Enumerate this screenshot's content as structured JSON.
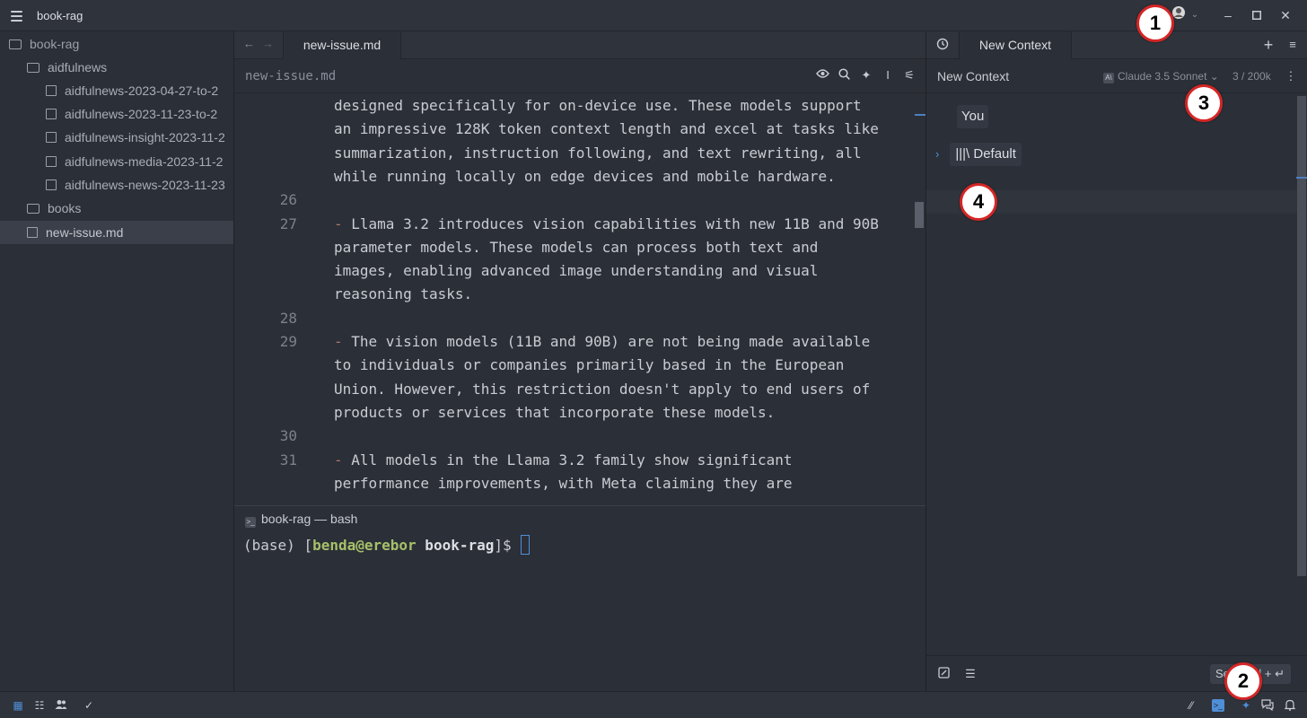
{
  "titlebar": {
    "title": "book-rag"
  },
  "sidebar": {
    "items": [
      {
        "label": "book-rag",
        "type": "folder"
      },
      {
        "label": "aidfulnews",
        "type": "folder"
      },
      {
        "label": "aidfulnews-2023-04-27-to-2",
        "type": "file"
      },
      {
        "label": "aidfulnews-2023-11-23-to-2",
        "type": "file"
      },
      {
        "label": "aidfulnews-insight-2023-11-2",
        "type": "file"
      },
      {
        "label": "aidfulnews-media-2023-11-2",
        "type": "file"
      },
      {
        "label": "aidfulnews-news-2023-11-23",
        "type": "file"
      },
      {
        "label": "books",
        "type": "folder"
      },
      {
        "label": "new-issue.md",
        "type": "file",
        "selected": true
      }
    ]
  },
  "editor": {
    "tab_label": "new-issue.md",
    "breadcrumb": "new-issue.md",
    "lines": [
      {
        "num": "",
        "text": "designed specifically for on-device use. These models support"
      },
      {
        "num": "",
        "text": "an impressive 128K token context length and excel at tasks like"
      },
      {
        "num": "",
        "text": "summarization, instruction following, and text rewriting, all"
      },
      {
        "num": "",
        "text": "while running locally on edge devices and mobile hardware."
      },
      {
        "num": "26",
        "text": ""
      },
      {
        "num": "27",
        "text": " Llama 3.2 introduces vision capabilities with new 11B and 90B",
        "dash": "-"
      },
      {
        "num": "",
        "text": "parameter models. These models can process both text and"
      },
      {
        "num": "",
        "text": "images, enabling advanced image understanding and visual"
      },
      {
        "num": "",
        "text": "reasoning tasks."
      },
      {
        "num": "28",
        "text": ""
      },
      {
        "num": "29",
        "text": " The vision models (11B and 90B) are not being made available",
        "dash": "-"
      },
      {
        "num": "",
        "text": "to individuals or companies primarily based in the European"
      },
      {
        "num": "",
        "text": "Union. However, this restriction doesn't apply to end users of"
      },
      {
        "num": "",
        "text": "products or services that incorporate these models."
      },
      {
        "num": "30",
        "text": ""
      },
      {
        "num": "31",
        "text": " All models in the Llama 3.2 family show significant",
        "dash": "-"
      },
      {
        "num": "",
        "text": "performance improvements, with Meta claiming they are"
      }
    ]
  },
  "terminal": {
    "tab_label": "book-rag — bash",
    "prompt_env": "(base) ",
    "prompt_open": "[",
    "prompt_user": "benda@erebor",
    "prompt_dir": " book-rag",
    "prompt_close": "]$"
  },
  "assistant": {
    "tab_label": "New Context",
    "context_title": "New Context",
    "model": "Claude 3.5 Sonnet",
    "model_badge": "A\\",
    "token_count": "3 / 200k",
    "you_label": "You",
    "default_label": "Default",
    "default_icon": "|||\\",
    "send_label": "Send  ctrl + ↵"
  },
  "callouts": [
    "1",
    "2",
    "3",
    "4"
  ],
  "colors": {
    "callout_border": "#d42626",
    "accent": "#4f8fd7",
    "prompt_user": "#a7c06a"
  }
}
